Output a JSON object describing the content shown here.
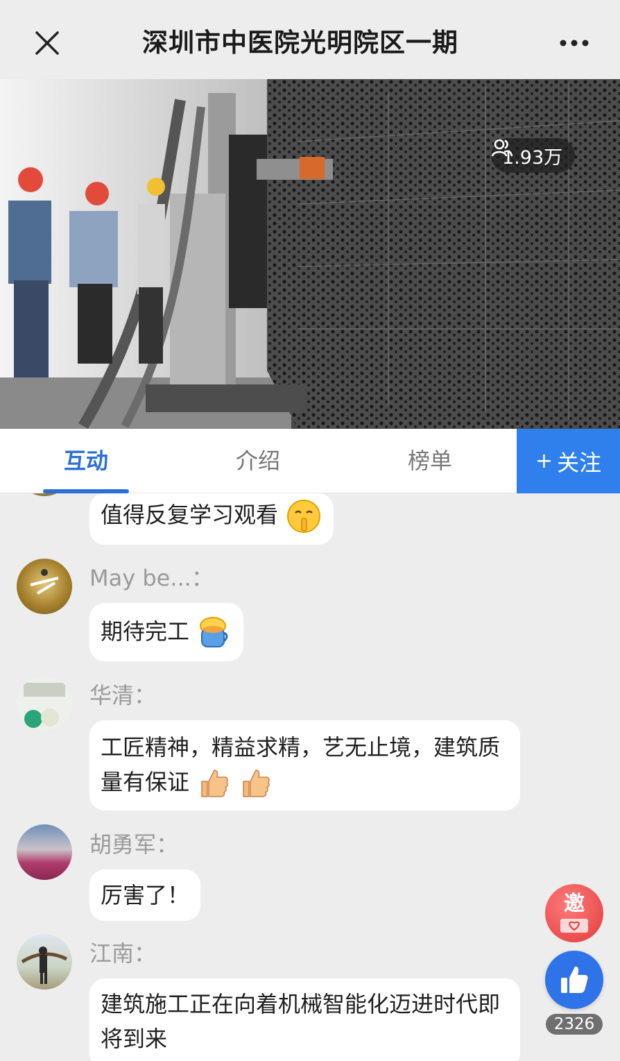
{
  "header": {
    "title": "深圳市中医院光明院区一期",
    "close_icon": "close-icon",
    "more_icon": "more-dots-icon"
  },
  "video": {
    "viewer_count": "1.93万",
    "viewer_icon": "people-icon"
  },
  "tabs": [
    {
      "label": "互动",
      "active": true
    },
    {
      "label": "介绍",
      "active": false
    },
    {
      "label": "榜单",
      "active": false
    }
  ],
  "follow": {
    "label": "关注",
    "icon": "plus-icon"
  },
  "comments": [
    {
      "name": "",
      "text": "值得反复学习观看",
      "emoji": "shush-face"
    },
    {
      "name": "May be...：",
      "text": "期待完工",
      "emoji": "coffee-cup"
    },
    {
      "name": "华清：",
      "text": "工匠精神，精益求精，艺无止境，建筑质量有保证",
      "emoji": "thumbs-up x2"
    },
    {
      "name": "胡勇军：",
      "text": "厉害了！",
      "emoji": ""
    },
    {
      "name": "江南：",
      "text": "建筑施工正在向着机械智能化迈进时代即将到来",
      "emoji": ""
    }
  ],
  "floating": {
    "invite_label": "邀",
    "like_count": "2326",
    "like_icon": "thumbs-up-icon"
  },
  "colors": {
    "accent": "#2c6fd6",
    "follow_bg": "#2f80ed",
    "background": "#ededed",
    "invite": "#e03c3c"
  }
}
